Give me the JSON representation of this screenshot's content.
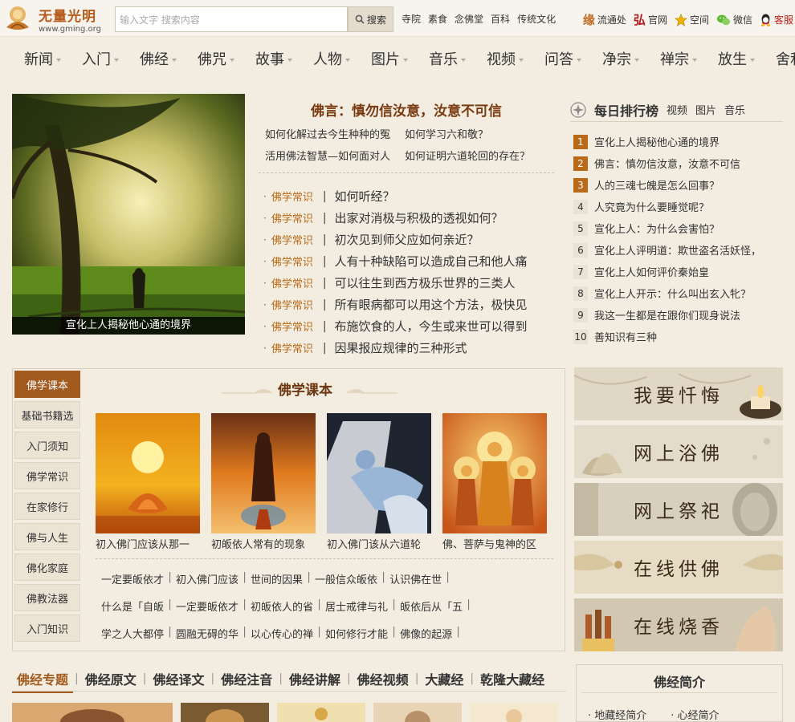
{
  "header": {
    "logo_name": "无量光明",
    "logo_url": "www.gming.org",
    "search_placeholder": "输入文字  搜索内容",
    "search_button": "搜索",
    "top_links": [
      "寺院",
      "素食",
      "念佛堂",
      "百科",
      "传统文化"
    ],
    "right_links": [
      {
        "icon": "yuan",
        "glyph": "缘",
        "label": "流通处"
      },
      {
        "icon": "hong",
        "glyph": "弘",
        "label": "官网"
      },
      {
        "icon": "star-icon",
        "label": "空间"
      },
      {
        "icon": "wechat-icon",
        "label": "微信"
      },
      {
        "icon": "qq-icon",
        "label": "客服"
      }
    ]
  },
  "nav": [
    "新闻",
    "入门",
    "佛经",
    "佛咒",
    "故事",
    "人物",
    "图片",
    "音乐",
    "视频",
    "问答",
    "净宗",
    "禅宗",
    "放生",
    "舍利"
  ],
  "hero": {
    "caption": "宣化上人揭秘他心通的境界"
  },
  "headline": "佛言：慎勿信汝意，汝意不可信",
  "sublinks": [
    [
      "如何化解过去今生种种的冤",
      "如何学习六和敬？"
    ],
    [
      "活用佛法智慧—如何面对人",
      "如何证明六道轮回的存在？"
    ]
  ],
  "news": [
    {
      "tag": "佛学常识",
      "title": "如何听经？"
    },
    {
      "tag": "佛学常识",
      "title": "出家对消极与积极的透视如何？"
    },
    {
      "tag": "佛学常识",
      "title": "初次见到师父应如何亲近？"
    },
    {
      "tag": "佛学常识",
      "title": "人有十种缺陷可以造成自己和他人痛"
    },
    {
      "tag": "佛学常识",
      "title": "可以往生到西方极乐世界的三类人"
    },
    {
      "tag": "佛学常识",
      "title": "所有眼病都可以用这个方法，极快见"
    },
    {
      "tag": "佛学常识",
      "title": "布施饮食的人，今生或来世可以得到"
    },
    {
      "tag": "佛学常识",
      "title": "因果报应规律的三种形式"
    }
  ],
  "ranking": {
    "title": "每日排行榜",
    "tabs": [
      "视频",
      "图片",
      "音乐"
    ],
    "items": [
      {
        "num": "1",
        "title": "宣化上人揭秘他心通的境界"
      },
      {
        "num": "2",
        "title": "佛言：慎勿信汝意，汝意不可信"
      },
      {
        "num": "3",
        "title": "人的三魂七魄是怎么回事？"
      },
      {
        "num": "4",
        "title": "人究竟为什么要睡觉呢？"
      },
      {
        "num": "5",
        "title": "宣化上人：为什么会害怕？"
      },
      {
        "num": "6",
        "title": "宣化上人评明道：欺世盗名活妖怪，"
      },
      {
        "num": "7",
        "title": "宣化上人如何评价秦始皇"
      },
      {
        "num": "8",
        "title": "宣化上人开示：什么叫出玄入牝？"
      },
      {
        "num": "9",
        "title": "我这一生都是在跟你们现身说法"
      },
      {
        "num": "10",
        "title": "善知识有三种"
      }
    ]
  },
  "textbook": {
    "sidebar": [
      "佛学课本",
      "基础书籍选",
      "入门须知",
      "佛学常识",
      "在家修行",
      "佛与人生",
      "佛化家庭",
      "佛教法器",
      "入门知识"
    ],
    "title": "佛学课本",
    "thumbs": [
      {
        "caption": "初入佛门应该从那一"
      },
      {
        "caption": "初皈依人常有的现象"
      },
      {
        "caption": "初入佛门该从六道轮"
      },
      {
        "caption": "佛、菩萨与鬼神的区"
      }
    ],
    "link_rows": [
      [
        "一定要皈依才",
        "初入佛门应该",
        "世间的因果",
        "一般信众皈依",
        "认识佛在世"
      ],
      [
        "什么是「自皈",
        "一定要皈依才",
        "初皈依人的省",
        "居士戒律与礼",
        "皈依后从「五"
      ],
      [
        "学之人大都停",
        "圆融无碍的华",
        "以心传心的禅",
        "如何修行才能",
        "佛像的起源"
      ]
    ]
  },
  "banners": [
    "我要忏悔",
    "网上浴佛",
    "网上祭祀",
    "在线供佛",
    "在线烧香"
  ],
  "bottom_tabs": [
    "佛经专题",
    "佛经原文",
    "佛经译文",
    "佛经注音",
    "佛经讲解",
    "佛经视频",
    "大藏经",
    "乾隆大藏经"
  ],
  "intro": {
    "title": "佛经简介",
    "links": [
      "地藏经简介",
      "心经简介"
    ]
  },
  "colors": {
    "accent": "#a25a1e",
    "tag": "#b86a18",
    "background": "#f2ede0",
    "hot_rank": "#b86a18"
  }
}
